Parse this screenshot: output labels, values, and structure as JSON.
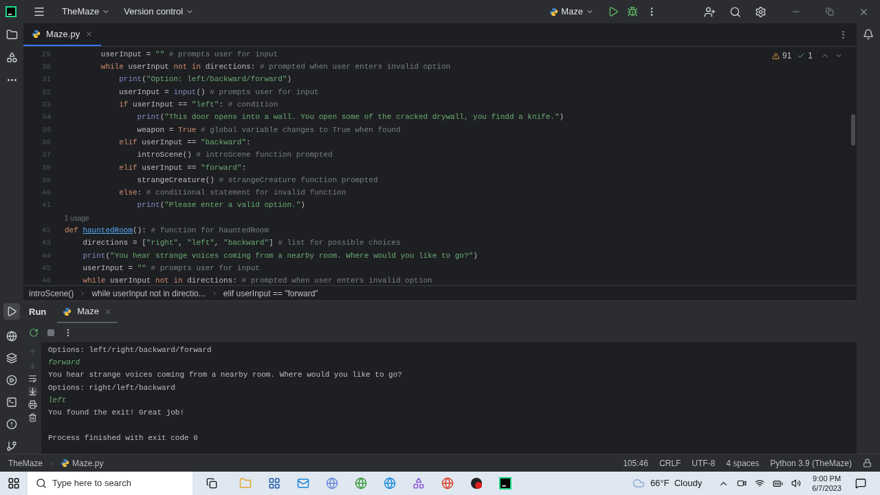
{
  "title_bar": {
    "project": "TheMaze",
    "vcs": "Version control",
    "run_config": "Maze"
  },
  "editor": {
    "tabs": [
      {
        "label": "Maze.py",
        "selected": true
      }
    ],
    "warnings": "91",
    "checks": "1",
    "lines": [
      {
        "kind": "code",
        "number": "29",
        "tokens": [
          {
            "kind": "plain",
            "text": "        userInput = "
          },
          {
            "kind": "str",
            "text": "\"\""
          },
          {
            "kind": "comment",
            "text": " # prompts user for input"
          }
        ]
      },
      {
        "kind": "code",
        "number": "30",
        "tokens": [
          {
            "kind": "kw",
            "text": "        while "
          },
          {
            "kind": "plain",
            "text": "userInput "
          },
          {
            "kind": "kw",
            "text": "not in "
          },
          {
            "kind": "plain",
            "text": "directions:"
          },
          {
            "kind": "comment",
            "text": " # prompted when user enters invalid option"
          }
        ]
      },
      {
        "kind": "code",
        "number": "31",
        "tokens": [
          {
            "kind": "builtin",
            "text": "            print"
          },
          {
            "kind": "plain",
            "text": "("
          },
          {
            "kind": "str",
            "text": "\"Option: left/backward/forward\""
          },
          {
            "kind": "plain",
            "text": ")"
          }
        ]
      },
      {
        "kind": "code",
        "number": "32",
        "tokens": [
          {
            "kind": "plain",
            "text": "            userInput = "
          },
          {
            "kind": "builtin",
            "text": "input"
          },
          {
            "kind": "plain",
            "text": "()"
          },
          {
            "kind": "comment",
            "text": " # prompts user for input"
          }
        ]
      },
      {
        "kind": "code",
        "number": "33",
        "tokens": [
          {
            "kind": "kw",
            "text": "            if "
          },
          {
            "kind": "plain",
            "text": "userInput == "
          },
          {
            "kind": "str",
            "text": "\"left\""
          },
          {
            "kind": "plain",
            "text": ":"
          },
          {
            "kind": "comment",
            "text": " # condition"
          }
        ]
      },
      {
        "kind": "code",
        "number": "34",
        "tokens": [
          {
            "kind": "builtin",
            "text": "                print"
          },
          {
            "kind": "plain",
            "text": "("
          },
          {
            "kind": "str",
            "text": "\"This door opens into a wall. You open some of the cracked drywall, you findd a knife.\""
          },
          {
            "kind": "plain",
            "text": ")"
          }
        ]
      },
      {
        "kind": "code",
        "number": "35",
        "tokens": [
          {
            "kind": "plain",
            "text": "                weapon = "
          },
          {
            "kind": "kw",
            "text": "True"
          },
          {
            "kind": "comment",
            "text": " # global variable changes to True when found"
          }
        ]
      },
      {
        "kind": "code",
        "number": "36",
        "tokens": [
          {
            "kind": "kw",
            "text": "            elif "
          },
          {
            "kind": "plain",
            "text": "userInput == "
          },
          {
            "kind": "str",
            "text": "\"backward\""
          },
          {
            "kind": "plain",
            "text": ":"
          }
        ]
      },
      {
        "kind": "code",
        "number": "37",
        "tokens": [
          {
            "kind": "plain",
            "text": "                introScene()"
          },
          {
            "kind": "comment",
            "text": " # introScene function prompted"
          }
        ]
      },
      {
        "kind": "code",
        "number": "38",
        "tokens": [
          {
            "kind": "kw",
            "text": "            elif "
          },
          {
            "kind": "plain",
            "text": "userInput == "
          },
          {
            "kind": "str",
            "text": "\"forward\""
          },
          {
            "kind": "plain",
            "text": ":"
          }
        ]
      },
      {
        "kind": "code",
        "number": "39",
        "tokens": [
          {
            "kind": "plain",
            "text": "                strangeCreature()"
          },
          {
            "kind": "comment",
            "text": " # strangeCreature function prompted"
          }
        ]
      },
      {
        "kind": "code",
        "number": "40",
        "tokens": [
          {
            "kind": "kw",
            "text": "            else"
          },
          {
            "kind": "plain",
            "text": ":"
          },
          {
            "kind": "comment",
            "text": " # conditional statement for invalid function"
          }
        ]
      },
      {
        "kind": "code",
        "number": "41",
        "tokens": [
          {
            "kind": "builtin",
            "text": "                print"
          },
          {
            "kind": "plain",
            "text": "("
          },
          {
            "kind": "str",
            "text": "\"Please enter a valid option.\""
          },
          {
            "kind": "plain",
            "text": ")"
          }
        ]
      },
      {
        "kind": "hint",
        "text": "1 usage"
      },
      {
        "kind": "code",
        "number": "42",
        "tokens": [
          {
            "kind": "kw",
            "text": "def "
          },
          {
            "kind": "fndef",
            "text": "hauntedRoom"
          },
          {
            "kind": "plain",
            "text": "():"
          },
          {
            "kind": "comment",
            "text": " # function for hauntedRoom"
          }
        ]
      },
      {
        "kind": "code",
        "number": "43",
        "tokens": [
          {
            "kind": "plain",
            "text": "    directions = ["
          },
          {
            "kind": "str",
            "text": "\"right\""
          },
          {
            "kind": "plain",
            "text": ", "
          },
          {
            "kind": "str",
            "text": "\"left\""
          },
          {
            "kind": "plain",
            "text": ", "
          },
          {
            "kind": "str",
            "text": "\"backward\""
          },
          {
            "kind": "plain",
            "text": "]"
          },
          {
            "kind": "comment",
            "text": " # list for possible choices"
          }
        ]
      },
      {
        "kind": "code",
        "number": "44",
        "tokens": [
          {
            "kind": "builtin",
            "text": "    print"
          },
          {
            "kind": "plain",
            "text": "("
          },
          {
            "kind": "str",
            "text": "\"You hear strange voices coming from a nearby room. Where would you like to go?\""
          },
          {
            "kind": "plain",
            "text": ")"
          }
        ]
      },
      {
        "kind": "code",
        "number": "45",
        "tokens": [
          {
            "kind": "plain",
            "text": "    userInput = "
          },
          {
            "kind": "str",
            "text": "\"\""
          },
          {
            "kind": "comment",
            "text": " # prompts user for input"
          }
        ]
      },
      {
        "kind": "code",
        "number": "46",
        "tokens": [
          {
            "kind": "kw",
            "text": "    while "
          },
          {
            "kind": "plain",
            "text": "userInput "
          },
          {
            "kind": "kw",
            "text": "not in "
          },
          {
            "kind": "plain",
            "text": "directions:"
          },
          {
            "kind": "comment",
            "text": " # prompted when user enters invalid option"
          }
        ]
      }
    ]
  },
  "breadcrumbs": [
    "introScene()",
    "while userInput not in directio...",
    "elif userInput == \"forward\""
  ],
  "run_panel": {
    "title": "Run",
    "tabs": [
      {
        "label": "Maze",
        "selected": true
      }
    ],
    "console": [
      {
        "kind": "output",
        "text": "Options: left/right/backward/forward"
      },
      {
        "kind": "input",
        "text": "forward"
      },
      {
        "kind": "output",
        "text": "You hear strange voices coming from a nearby room. Where would you like to go?"
      },
      {
        "kind": "output",
        "text": "Options: right/left/backward"
      },
      {
        "kind": "input",
        "text": "left"
      },
      {
        "kind": "output",
        "text": "You found the exit! Great job!"
      },
      {
        "kind": "blank"
      },
      {
        "kind": "output",
        "text": "Process finished with exit code 0"
      }
    ]
  },
  "status_bar": {
    "path": [
      "TheMaze",
      "Maze.py"
    ],
    "position": "105:46",
    "line_ending": "CRLF",
    "encoding": "UTF-8",
    "indent": "4 spaces",
    "interpreter": "Python 3.9 (TheMaze)"
  },
  "taskbar": {
    "search_placeholder": "Type here to search",
    "weather": "66°F  Cloudy",
    "time": "9:00 PM",
    "date": "6/7/2023"
  }
}
